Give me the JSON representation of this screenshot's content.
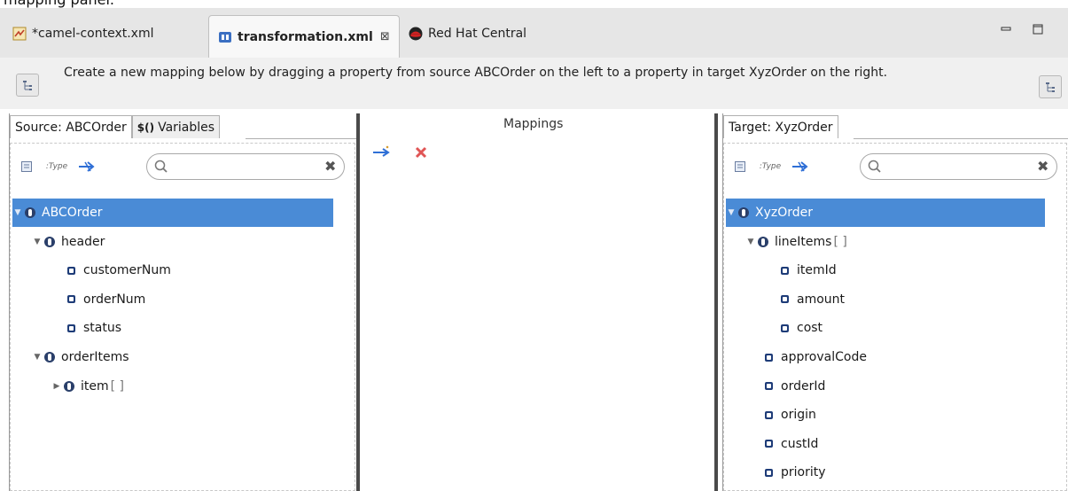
{
  "caption": "mapping panel.",
  "tabs": [
    {
      "label": "*camel-context.xml",
      "icon": "camel-context-file-icon"
    },
    {
      "label": "transformation.xml",
      "icon": "transformation-editor-icon",
      "close": "⊠"
    },
    {
      "label": "Red Hat Central",
      "icon": "red-hat-icon"
    }
  ],
  "instruction": "Create a new mapping below by dragging a property from source ABCOrder on the left to a property in target XyzOrder  on the right.",
  "source": {
    "tab_label": "Source: ABCOrder",
    "variables_prefix": "$()",
    "variables_label": "Variables",
    "search_placeholder": "",
    "tree": [
      {
        "label": "ABCOrder",
        "kind": "node",
        "expander": "▼"
      },
      {
        "label": "header",
        "kind": "node",
        "expander": "▼"
      },
      {
        "label": "customerNum",
        "kind": "leaf"
      },
      {
        "label": "orderNum",
        "kind": "leaf"
      },
      {
        "label": "status",
        "kind": "leaf"
      },
      {
        "label": "orderItems",
        "kind": "node",
        "expander": "▼"
      },
      {
        "label": "item",
        "kind": "node",
        "expander": "▶",
        "suffix": "[ ]"
      }
    ]
  },
  "mappings": {
    "title": "Mappings"
  },
  "target": {
    "tab_label": "Target: XyzOrder",
    "search_placeholder": "",
    "tree": [
      {
        "label": "XyzOrder",
        "kind": "node",
        "expander": "▼"
      },
      {
        "label": "lineItems",
        "kind": "node",
        "expander": "▼",
        "suffix": "[ ]"
      },
      {
        "label": "itemId",
        "kind": "leaf"
      },
      {
        "label": "amount",
        "kind": "leaf"
      },
      {
        "label": "cost",
        "kind": "leaf"
      },
      {
        "label": "approvalCode",
        "kind": "leaf"
      },
      {
        "label": "orderId",
        "kind": "leaf"
      },
      {
        "label": "origin",
        "kind": "leaf"
      },
      {
        "label": "custId",
        "kind": "leaf"
      },
      {
        "label": "priority",
        "kind": "leaf"
      }
    ]
  },
  "tool_labels": {
    "type": ":Type"
  },
  "colors": {
    "selection": "#4a8bd6",
    "accent_blue": "#2f6fd6",
    "delete_red": "#e05555"
  }
}
